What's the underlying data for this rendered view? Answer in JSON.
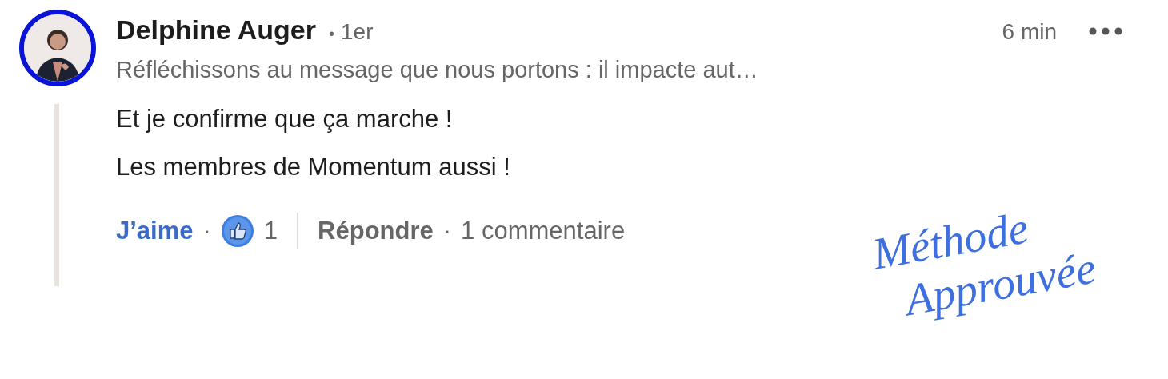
{
  "comment": {
    "author": "Delphine Auger",
    "degree_separator": "•",
    "degree": "1er",
    "time": "6 min",
    "headline": "Réfléchissons au message que nous portons : il impacte aut…",
    "body": [
      "Et je confirme que ça marche !",
      "Les membres de Momentum aussi !"
    ],
    "actions": {
      "like": {
        "label": "J’aime",
        "liked": true
      },
      "separator_1": "·",
      "reaction_count": "1",
      "reply": "Répondre",
      "separator_2": "·",
      "replies": "1 commentaire"
    }
  },
  "annotation": {
    "lines": [
      "Méthode",
      "Approuvée"
    ]
  }
}
